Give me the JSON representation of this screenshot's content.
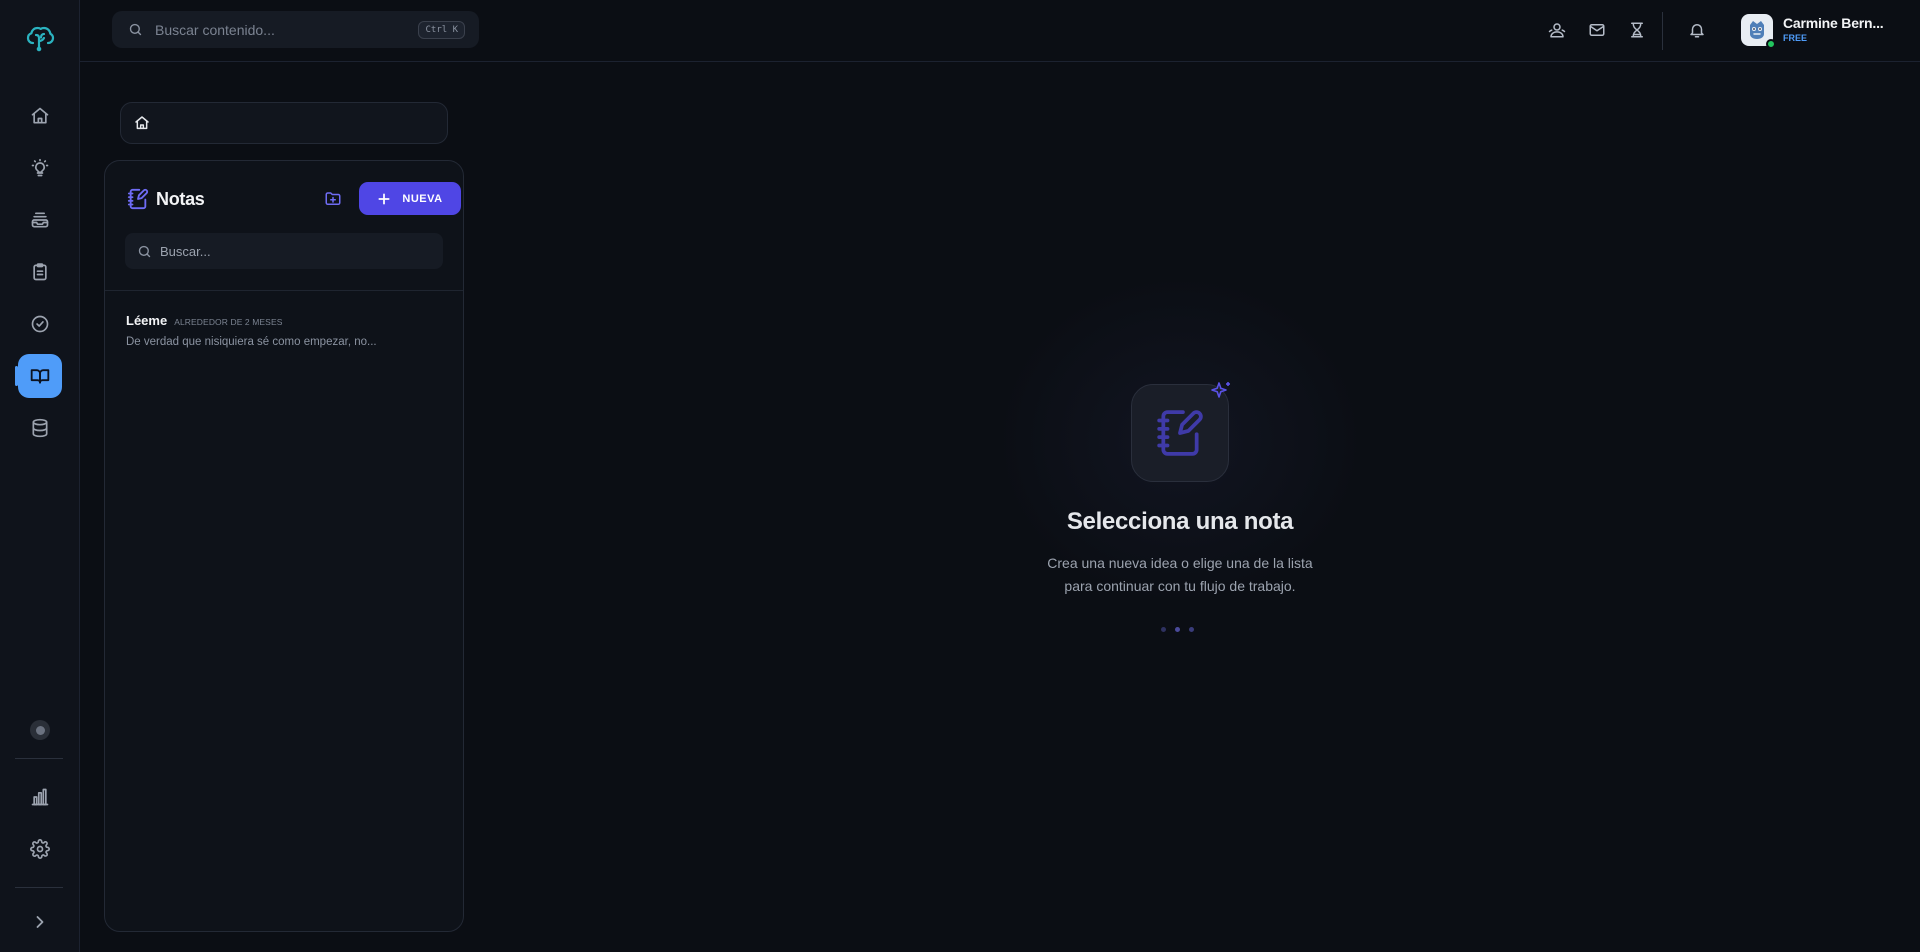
{
  "rail": {
    "logo_icon": "brain-logo-icon",
    "accent": "#4f9cf9",
    "items": [
      {
        "icon": "home-icon"
      },
      {
        "icon": "lightbulb-icon"
      },
      {
        "icon": "inbox-stack-icon"
      },
      {
        "icon": "clipboard-icon"
      },
      {
        "icon": "check-circle-icon"
      },
      {
        "icon": "book-open-icon",
        "active": true
      },
      {
        "icon": "database-icon"
      }
    ],
    "bottom": [
      {
        "icon": "status-dot-icon"
      },
      {
        "icon": "bar-chart-icon"
      },
      {
        "icon": "settings-gear-icon"
      },
      {
        "icon": "chevron-right-icon"
      }
    ]
  },
  "topbar": {
    "search_placeholder": "Buscar contenido...",
    "search_shortcut": "Ctrl K",
    "icons": [
      "users-icon",
      "mail-icon",
      "trophy-icon",
      "bell-icon"
    ],
    "user": {
      "name": "Carmine Bern...",
      "plan": "FREE",
      "status_color": "#22c55e"
    }
  },
  "breadcrumb": {
    "home_icon": "home-icon"
  },
  "notes": {
    "title": "Notas",
    "new_button": "NUEVA",
    "search_placeholder": "Buscar...",
    "accent": "#4f46e5",
    "items": [
      {
        "title": "Léeme",
        "time": "ALREDEDOR DE 2 MESES",
        "preview": "De verdad que nisiquiera sé como empezar, no..."
      }
    ]
  },
  "empty_state": {
    "icon": "notebook-pen-icon",
    "title": "Selecciona una nota",
    "description_line1": "Crea una nueva idea o elige una de la lista",
    "description_line2": "para continuar con tu flujo de trabajo.",
    "dot_colors": [
      "#2e3160",
      "#4a4a9a",
      "#3a3c7a"
    ]
  }
}
